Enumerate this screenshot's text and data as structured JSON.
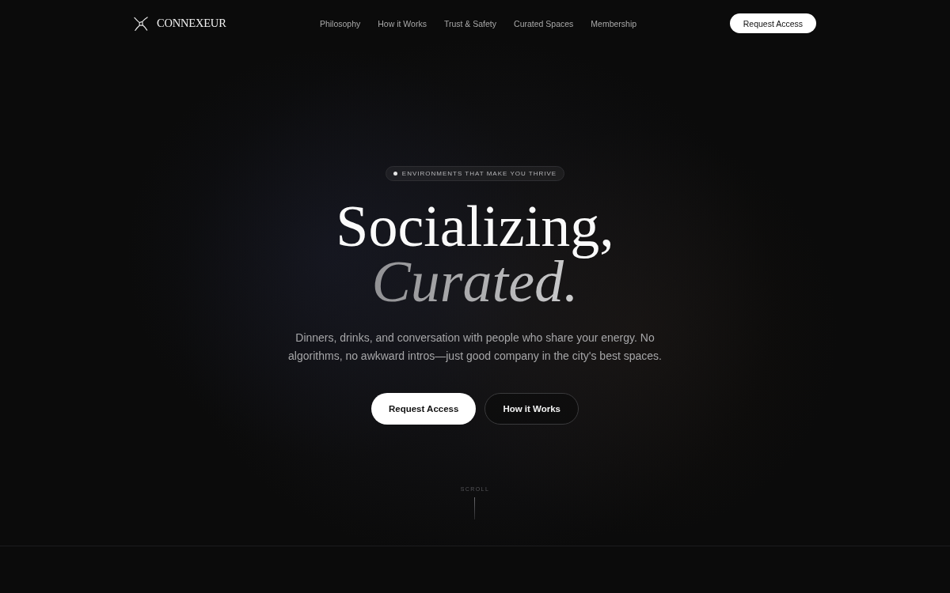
{
  "header": {
    "logo": {
      "text": "CONNEXEUR"
    },
    "nav": [
      "Philosophy",
      "How it Works",
      "Trust & Safety",
      "Curated Spaces",
      "Membership"
    ],
    "cta": "Request Access"
  },
  "hero": {
    "badge": "ENVIRONMENTS THAT MAKE YOU THRIVE",
    "headline": [
      {
        "text": "Socializing,",
        "kind": "plain"
      },
      {
        "text": "Curated.",
        "kind": "accent"
      }
    ],
    "description": "Dinners, drinks, and conversation with people who share your energy. No algorithms, no awkward intros—just good company in the city's best spaces.",
    "buttons": [
      {
        "label": "Request Access",
        "kind": "primary"
      },
      {
        "label": "How it Works",
        "kind": "outline"
      }
    ]
  },
  "scroll_hint": {
    "label": "SCROLL"
  }
}
